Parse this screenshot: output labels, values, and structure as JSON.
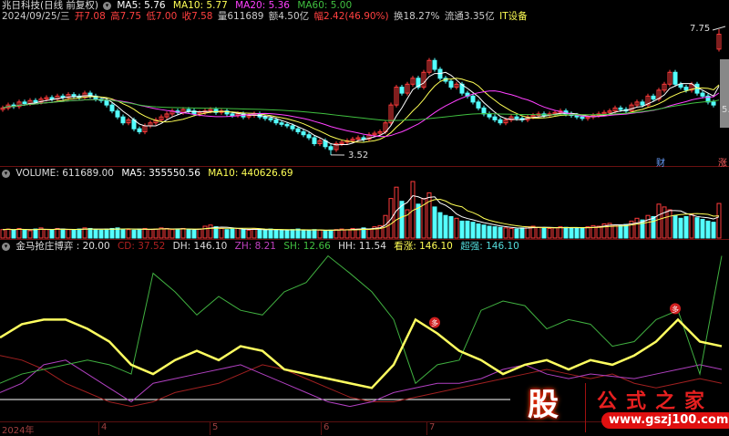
{
  "header": {
    "stock_name": "兆日科技(日线 前复权)",
    "ma5": "MA5: 5.76",
    "ma10": "MA10: 5.77",
    "ma20": "MA20: 5.36",
    "ma60": "MA60: 5.00",
    "date": "2024/09/25/三",
    "open": "开7.08",
    "high": "高7.75",
    "low": "低7.00",
    "close": "收7.58",
    "volume": "量611689",
    "amount": "额4.50亿",
    "change": "幅2.42(46.90%)",
    "turnover": "换18.27%",
    "float": "流通3.35亿",
    "sector": "IT设备"
  },
  "volume_panel": {
    "title": "VOLUME: 611689.00",
    "ma5": "MA5: 355550.56",
    "ma10": "MA10: 440626.69"
  },
  "indicator_panel": {
    "title": "金马抢庄博弈",
    "value": ": 20.00",
    "cd": "CD: 37.52",
    "dh": "DH: 146.10",
    "zh": "ZH: 8.21",
    "sh": "SH: 12.66",
    "hh": "HH: 11.54",
    "xz": "看涨: 146.10",
    "cq": "超强: 146.10",
    "signal": "多"
  },
  "markers": {
    "high_label": "7.75",
    "low_label": "3.52",
    "cai": "财",
    "zhang": "涨",
    "right_price": "5."
  },
  "axis": {
    "year": "2024年",
    "months": [
      "4",
      "5",
      "6",
      "7"
    ]
  },
  "watermark": {
    "logo_char": "股",
    "site_name": "公式之家",
    "url": "www.gszj100.com"
  },
  "colors": {
    "up": "#ff3b3b",
    "down": "#54ffff",
    "ma5": "#ffffff",
    "ma10": "#ffff55",
    "ma20": "#ff40ff",
    "ma60": "#40c040"
  },
  "chart_data": {
    "type": "candlestick",
    "closes": [
      5.1,
      5.2,
      5.15,
      5.3,
      5.25,
      5.35,
      5.3,
      5.4,
      5.45,
      5.4,
      5.5,
      5.45,
      5.55,
      5.5,
      5.45,
      5.6,
      5.5,
      5.4,
      5.35,
      5.2,
      5.0,
      4.8,
      4.6,
      4.7,
      4.4,
      4.3,
      4.5,
      4.6,
      4.7,
      4.8,
      4.9,
      5.0,
      4.95,
      5.05,
      5.0,
      4.9,
      4.95,
      5.0,
      5.05,
      4.95,
      5.0,
      4.9,
      4.85,
      4.9,
      4.8,
      4.85,
      4.9,
      4.8,
      4.75,
      4.7,
      4.6,
      4.55,
      4.5,
      4.4,
      4.3,
      4.2,
      4.1,
      3.9,
      4.0,
      3.8,
      3.7,
      3.9,
      3.95,
      4.0,
      4.05,
      4.1,
      4.05,
      4.2,
      4.25,
      4.3,
      4.6,
      5.2,
      5.8,
      5.6,
      5.9,
      6.1,
      5.8,
      6.3,
      6.7,
      6.4,
      6.1,
      6.0,
      5.8,
      5.9,
      5.6,
      5.5,
      5.3,
      5.1,
      4.9,
      4.8,
      4.7,
      4.6,
      4.7,
      4.8,
      4.75,
      4.7,
      4.8,
      4.85,
      4.9,
      4.85,
      4.9,
      4.95,
      5.0,
      4.9,
      4.85,
      4.8,
      4.75,
      4.8,
      4.85,
      4.9,
      4.95,
      5.0,
      5.1,
      5.05,
      5.0,
      5.2,
      5.3,
      5.2,
      5.5,
      5.4,
      5.7,
      5.9,
      6.3,
      5.9,
      5.8,
      5.7,
      5.9,
      5.6,
      5.5,
      5.3,
      5.2,
      7.58
    ],
    "last_open": 7.08,
    "last_high": 7.75,
    "low_mark": 3.52,
    "volume_k": [
      150,
      160,
      140,
      170,
      150,
      130,
      160,
      180,
      150,
      140,
      170,
      160,
      150,
      140,
      160,
      180,
      170,
      150,
      140,
      160,
      170,
      180,
      160,
      150,
      140,
      160,
      170,
      150,
      160,
      180,
      170,
      150,
      160,
      170,
      150,
      140,
      160,
      210,
      230,
      200,
      170,
      150,
      160,
      170,
      150,
      140,
      160,
      150,
      140,
      160,
      150,
      140,
      130,
      150,
      160,
      140,
      130,
      150,
      140,
      130,
      140,
      150,
      160,
      150,
      170,
      160,
      180,
      150,
      200,
      220,
      400,
      700,
      900,
      650,
      500,
      1000,
      600,
      700,
      800,
      550,
      450,
      400,
      380,
      350,
      300,
      300,
      280,
      250,
      230,
      210,
      200,
      190,
      180,
      170,
      160,
      180,
      200,
      210,
      190,
      180,
      170,
      180,
      200,
      190,
      180,
      170,
      180,
      200,
      220,
      210,
      250,
      260,
      230,
      220,
      240,
      300,
      350,
      320,
      400,
      380,
      600,
      550,
      500,
      400,
      350,
      380,
      420,
      360,
      330,
      300,
      280,
      612
    ],
    "indicator": {
      "ylim": [
        0,
        146.1
      ],
      "baseline": 20,
      "yellow": [
        73.5,
        85,
        89,
        89,
        81,
        70,
        50,
        42,
        54,
        62,
        54,
        66,
        62,
        46,
        42,
        38,
        34,
        30,
        50,
        89,
        77,
        62,
        54,
        42,
        50,
        54,
        46,
        54,
        50,
        58,
        70,
        89,
        70,
        66
      ],
      "green": [
        34,
        42,
        46,
        50,
        54,
        50,
        42,
        129,
        113,
        93,
        109,
        97,
        93,
        113,
        121,
        144,
        129,
        113,
        89,
        34,
        50,
        54,
        97,
        105,
        101,
        81,
        89,
        85,
        66,
        70,
        89,
        97,
        42,
        144
      ],
      "purple": [
        26,
        34,
        50,
        54,
        42,
        30,
        18,
        34,
        38,
        42,
        46,
        50,
        42,
        34,
        26,
        18,
        14,
        18,
        26,
        30,
        34,
        34,
        38,
        46,
        50,
        42,
        38,
        42,
        40,
        38,
        42,
        46,
        50,
        46
      ],
      "darkred": [
        58,
        54,
        46,
        34,
        26,
        18,
        14,
        18,
        26,
        30,
        34,
        42,
        50,
        46,
        38,
        30,
        22,
        18,
        18,
        22,
        26,
        30,
        34,
        38,
        42,
        46,
        42,
        38,
        42,
        34,
        30,
        34,
        38,
        34
      ],
      "signals_at_index": [
        79,
        123
      ]
    }
  }
}
